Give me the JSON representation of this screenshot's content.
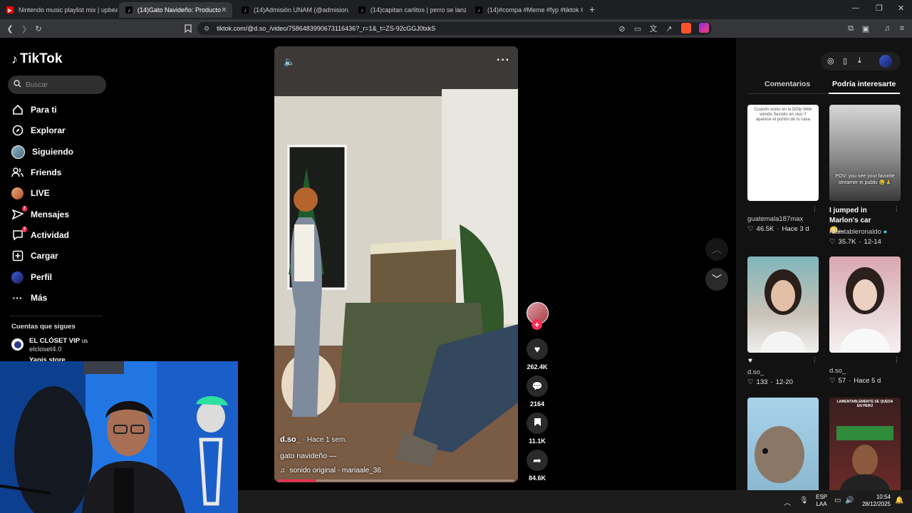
{
  "browser": {
    "tabs": [
      {
        "label": "Nintendo music playlist mix | upbeat",
        "active": false
      },
      {
        "label": "(14)Gato Navideño: Producto",
        "active": true
      },
      {
        "label": "(14)Admisión UNAM (@admision.un",
        "active": false
      },
      {
        "label": "(14)capitan carlitos | perro se lanza a",
        "active": false
      },
      {
        "label": "(14)#compa #Meme #fyp #tiktok #ti",
        "active": false
      }
    ],
    "new_tab": "+",
    "url": "tiktok.com/@d.so_/video/7586483990673116436?_r=1&_t=ZS-92cGGJ0txkS"
  },
  "tiktok": {
    "logo": "TikTok",
    "search_placeholder": "Buscar",
    "nav": [
      {
        "label": "Para ti",
        "icon": "home-icon"
      },
      {
        "label": "Explorar",
        "icon": "compass-icon"
      },
      {
        "label": "Siguiendo",
        "icon": "following-avatar-icon"
      },
      {
        "label": "Friends",
        "icon": "friends-icon"
      },
      {
        "label": "LIVE",
        "icon": "live-icon"
      },
      {
        "label": "Mensajes",
        "icon": "messages-icon",
        "badge": "7"
      },
      {
        "label": "Actividad",
        "icon": "activity-icon",
        "badge": "7"
      },
      {
        "label": "Cargar",
        "icon": "upload-icon"
      },
      {
        "label": "Perfil",
        "icon": "profile-icon"
      },
      {
        "label": "Más",
        "icon": "more-icon"
      }
    ],
    "following_title": "Cuentas que sigues",
    "following": [
      {
        "name": "EL CLÓSET VIP",
        "suffix": "us",
        "handle": "elcloset4.0"
      },
      {
        "name": "Yanis store",
        "suffix": "",
        "handle": ""
      }
    ]
  },
  "video": {
    "author": "d.so_",
    "time": "· Hace 1 sem.",
    "caption": "gato navideño —",
    "sound": "sonido original - mariaale_36",
    "likes": "262.4K",
    "comments": "2164",
    "saves": "11.1K",
    "shares": "84.6K",
    "progress": 0.16
  },
  "right": {
    "tabs": [
      "Comentarios",
      "Podría interesarte"
    ],
    "active_tab": "Podría interesarte",
    "items": [
      {
        "thumb_text": "Cuando estás en la DDtp Web viendo Secrets en vivo Y aparece el portón de tu casa",
        "title": "",
        "user": "guatemala187max",
        "likes": "46.5K",
        "date": "Hace 3 d",
        "theme": "white"
      },
      {
        "thumb_text": "POV: you see your favorite streamer in public 😂🙏",
        "title": "I jumped in Marlon's car 😳...",
        "user": "realstableronaldo",
        "likes": "35.7K",
        "date": "12-14",
        "theme": "grey"
      },
      {
        "thumb_text": "",
        "title": "♥",
        "user": "d.so_",
        "likes": "133",
        "date": "12-20",
        "theme": "teal"
      },
      {
        "thumb_text": "",
        "title": "",
        "user": "d.so_",
        "likes": "57",
        "date": "Hace 5 d",
        "theme": "pink"
      },
      {
        "thumb_text": "",
        "title": "",
        "user": "",
        "likes": "",
        "date": "",
        "theme": "blue"
      },
      {
        "thumb_text": "LAMENTABLEMENTE SE QUEDA EN PERÚ",
        "title": "",
        "user": "",
        "likes": "",
        "date": "",
        "theme": "red"
      }
    ]
  },
  "taskbar": {
    "lang1": "ESP",
    "lang2": "LAA",
    "time": "10:54",
    "date": "28/12/2025"
  },
  "colors": {
    "accent": "#fe2c55",
    "verified": "#20d5ec"
  }
}
